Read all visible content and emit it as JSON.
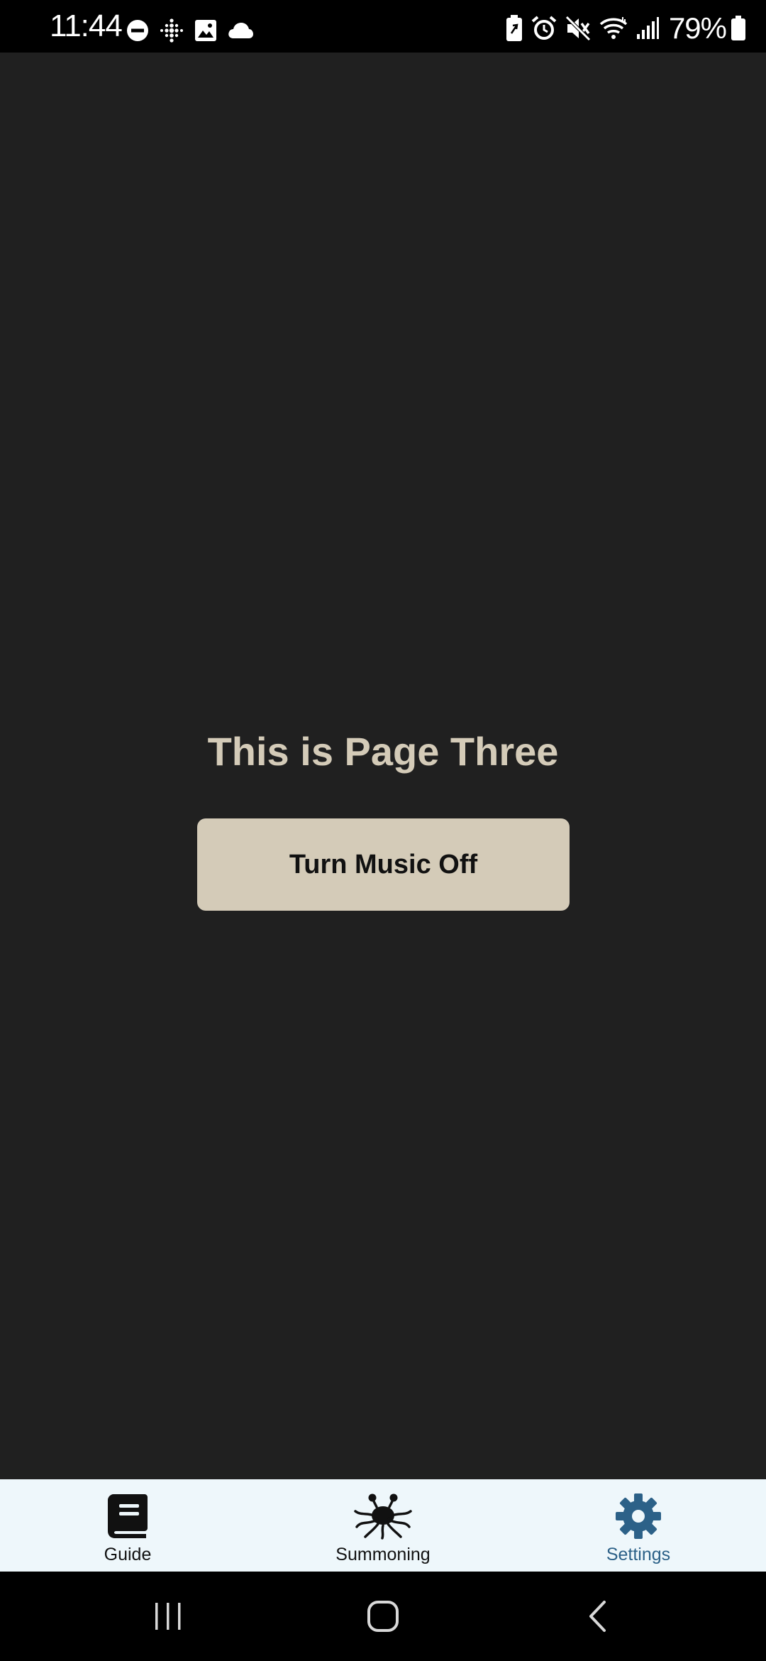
{
  "status_bar": {
    "time": "11:44",
    "left_icons": [
      "do-not-disturb-icon",
      "fitbit-icon",
      "gallery-icon",
      "cloud-icon"
    ],
    "right_icons": [
      "battery-saver-icon",
      "alarm-icon",
      "mute-icon",
      "wifi-icon",
      "signal-icon"
    ],
    "battery_percent": "79%"
  },
  "main": {
    "title": "This is Page Three",
    "music_button_label": "Turn Music Off"
  },
  "tab_bar": {
    "tabs": [
      {
        "label": "Guide",
        "icon": "book-icon",
        "active": false
      },
      {
        "label": "Summoning",
        "icon": "spaghetti-monster-icon",
        "active": false
      },
      {
        "label": "Settings",
        "icon": "gear-icon",
        "active": true
      }
    ]
  },
  "nav_bar": {
    "buttons": [
      "recent-apps-icon",
      "home-icon",
      "back-icon"
    ]
  },
  "colors": {
    "background": "#202020",
    "accent_beige": "#d4cbb8",
    "tab_bar_background": "#eef7fb",
    "active_tab": "#2c6188"
  }
}
